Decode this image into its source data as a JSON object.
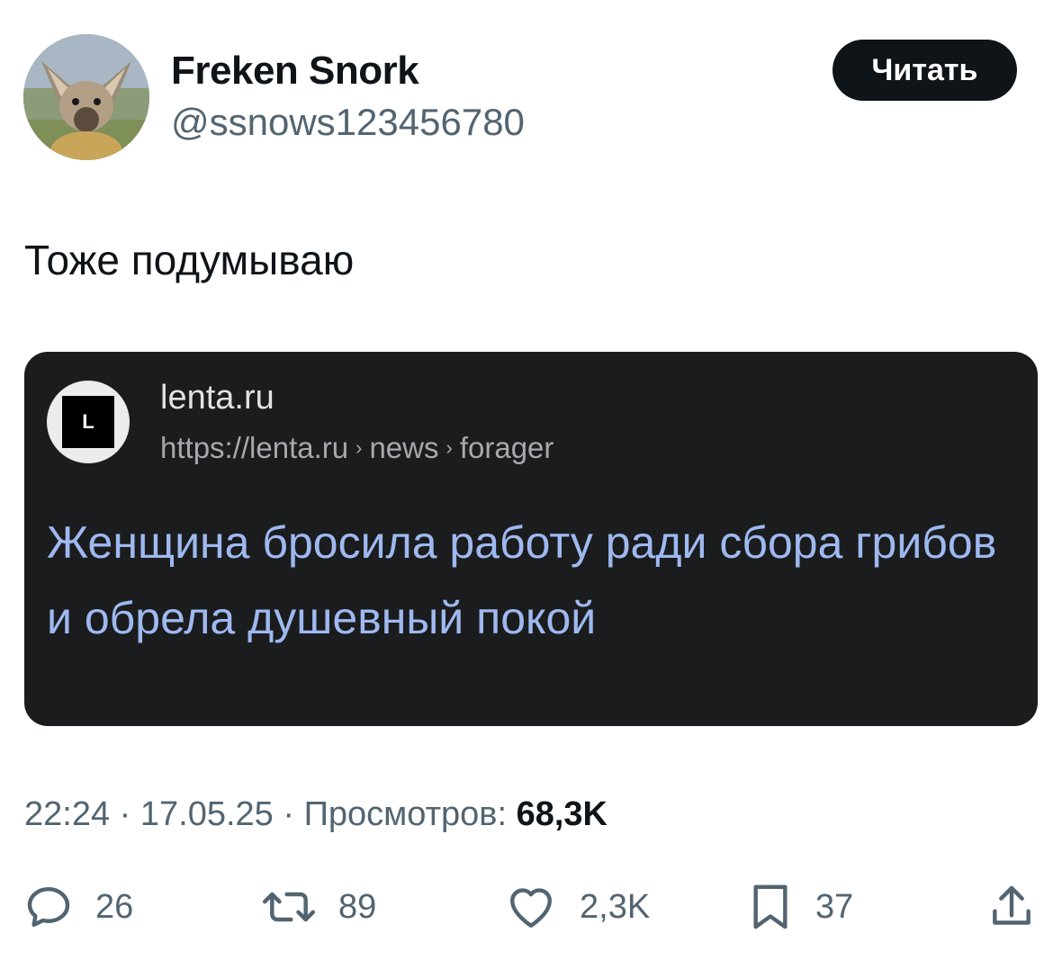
{
  "user": {
    "display_name": "Freken Snork",
    "handle": "@ssnows123456780",
    "avatar_icon": "bat-eared-fox-avatar"
  },
  "follow_button": {
    "label": "Читать"
  },
  "tweet": {
    "text": "Тоже подумываю"
  },
  "embedded_card": {
    "logo_letter": "L",
    "site_name": "lenta.ru",
    "url_parts": [
      "https://lenta.ru",
      "news",
      "forager"
    ],
    "url_separator": "›",
    "headline": "Женщина бросила работу ради сбора грибов и обрела душевный покой",
    "headline_color": "#9fb9f0",
    "background_color": "#1b1c1e"
  },
  "meta": {
    "time": "22:24",
    "dot": "·",
    "date": "17.05.25",
    "views_label": "Просмотров:",
    "views_count": "68,3K"
  },
  "actions": {
    "reply": {
      "icon": "reply-icon",
      "count": "26"
    },
    "repost": {
      "icon": "repost-icon",
      "count": "89"
    },
    "like": {
      "icon": "heart-icon",
      "count": "2,3K"
    },
    "bookmark": {
      "icon": "bookmark-icon",
      "count": "37"
    },
    "share": {
      "icon": "share-icon"
    }
  }
}
